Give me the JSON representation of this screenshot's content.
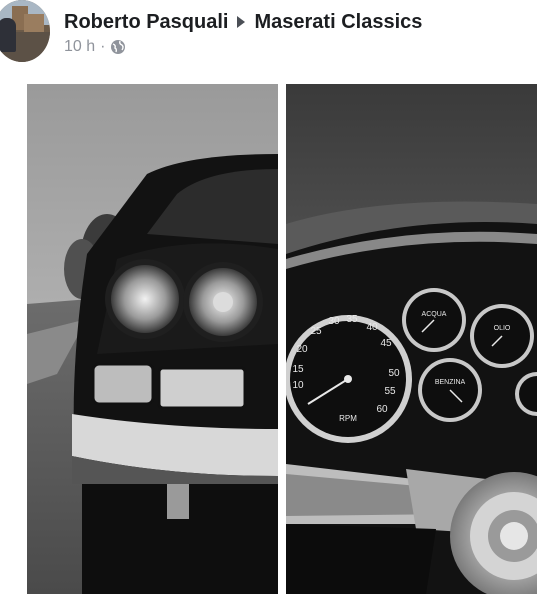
{
  "post": {
    "author": "Roberto Pasquali",
    "group": "Maserati Classics",
    "timestamp": "10 h",
    "separator": "·",
    "privacy_icon": "globe-icon"
  },
  "photos": [
    {
      "subject": "front of classic Maserati car with twin round headlights",
      "icon": "photo"
    },
    {
      "subject": "dashboard gauges and steering wheel",
      "icon": "photo"
    }
  ],
  "gauges": {
    "speedo_numbers": [
      "10",
      "15",
      "20",
      "25",
      "30",
      "35",
      "40",
      "45",
      "50",
      "55",
      "60"
    ],
    "speedo_unit": "RPM",
    "acqua": "ACQUA",
    "olio": "OLIO",
    "benzina": "BENZINA"
  },
  "colors": {
    "name_text": "#1c1e21",
    "meta_text": "#90949c"
  }
}
